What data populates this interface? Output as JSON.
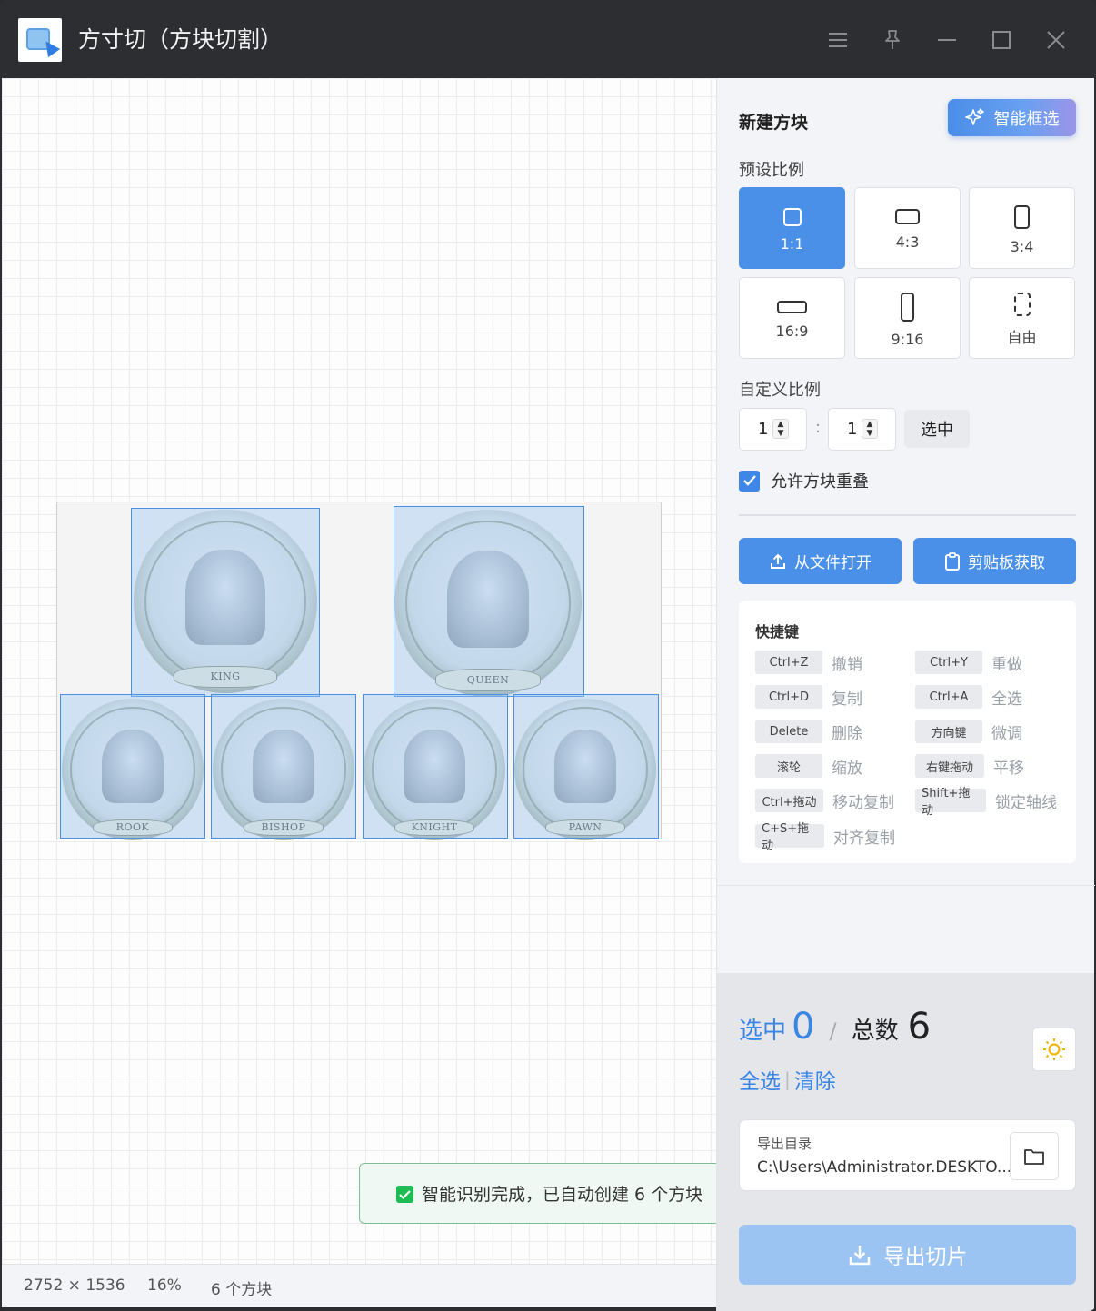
{
  "window": {
    "title": "方寸切（方块切割）"
  },
  "canvas": {
    "medallions": {
      "king": "KING",
      "queen": "QUEEN",
      "rook": "ROOK",
      "bishop": "BISHOP",
      "knight": "KNIGHT",
      "pawn": "PAWN"
    }
  },
  "toast": {
    "message": "智能识别完成，已自动创建 6 个方块"
  },
  "statusbar": {
    "dimensions": "2752 × 1536",
    "zoom": "16%",
    "block_count": "6 个方块"
  },
  "sidebar": {
    "new_block_title": "新建方块",
    "smart_select_label": "智能框选",
    "preset_ratio_label": "预设比例",
    "presets": [
      {
        "label": "1:1",
        "selected": true
      },
      {
        "label": "4:3",
        "selected": false
      },
      {
        "label": "3:4",
        "selected": false
      },
      {
        "label": "16:9",
        "selected": false
      },
      {
        "label": "9:16",
        "selected": false
      },
      {
        "label": "自由",
        "selected": false
      }
    ],
    "custom_ratio_label": "自定义比例",
    "custom_ratio": {
      "w": "1",
      "h": "1",
      "separator": ":"
    },
    "select_button": "选中",
    "allow_overlap_label": "允许方块重叠",
    "allow_overlap_checked": true,
    "open_file_button": "从文件打开",
    "clipboard_button": "剪贴板获取",
    "hotkeys_title": "快捷键",
    "hotkeys": [
      {
        "key": "Ctrl+Z",
        "desc": "撤销"
      },
      {
        "key": "Ctrl+Y",
        "desc": "重做"
      },
      {
        "key": "Ctrl+D",
        "desc": "复制"
      },
      {
        "key": "Ctrl+A",
        "desc": "全选"
      },
      {
        "key": "Delete",
        "desc": "删除"
      },
      {
        "key": "方向键",
        "desc": "微调"
      },
      {
        "key": "滚轮",
        "desc": "缩放"
      },
      {
        "key": "右键拖动",
        "desc": "平移"
      },
      {
        "key": "Ctrl+拖动",
        "desc": "移动复制"
      },
      {
        "key": "Shift+拖动",
        "desc": "锁定轴线"
      },
      {
        "key": "C+S+拖动",
        "desc": "对齐复制"
      }
    ],
    "selected_label": "选中",
    "selected_count": "0",
    "slash": "/",
    "total_label": "总数",
    "total_count": "6",
    "select_all_link": "全选",
    "link_separator": "|",
    "clear_link": "清除",
    "export_dir_label": "导出目录",
    "export_dir_path": "C:\\Users\\Administrator.DESKTO...",
    "export_button": "导出切片"
  },
  "colors": {
    "accent": "#4a90e8",
    "titlebar": "#2d2e31",
    "success": "#1dbb54"
  }
}
